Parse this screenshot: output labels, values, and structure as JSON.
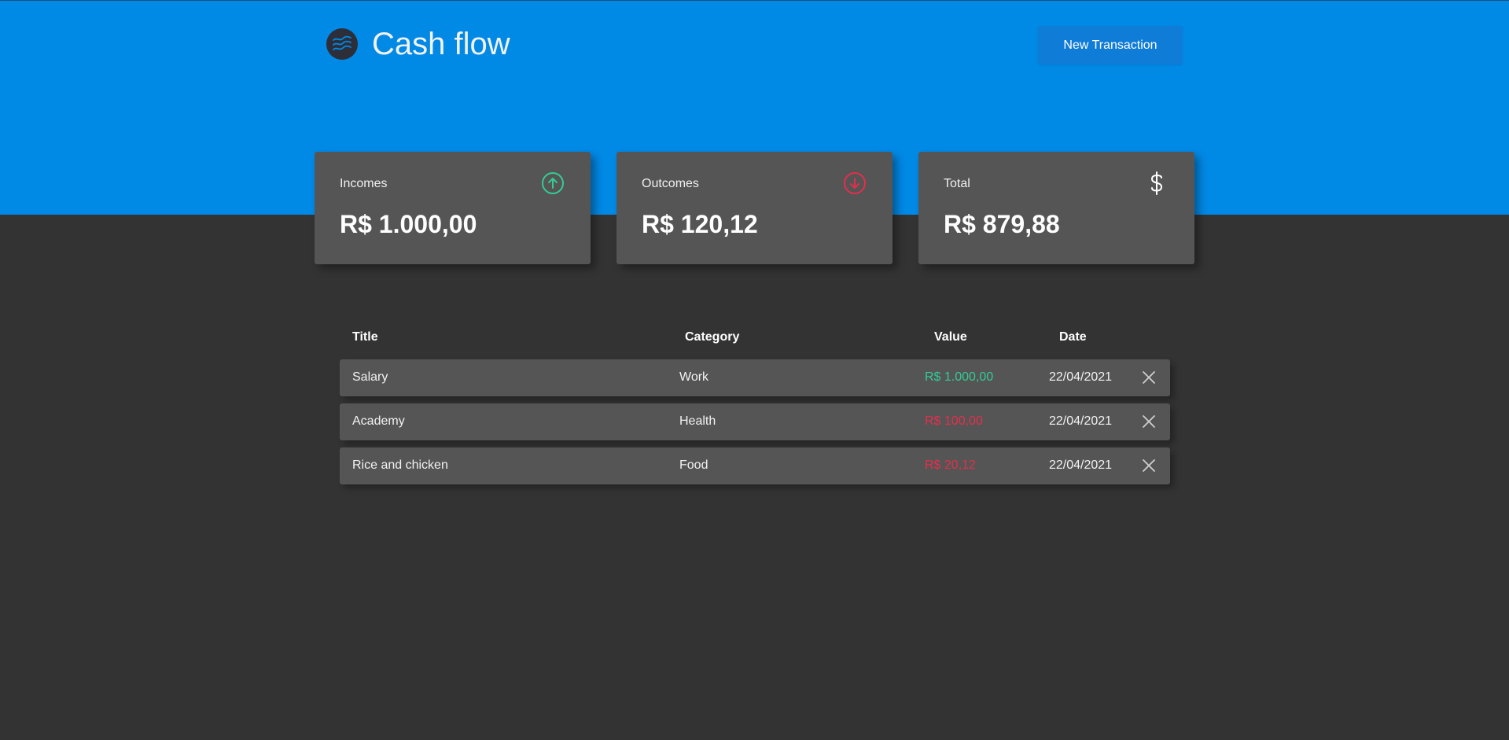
{
  "header": {
    "title": "Cash flow",
    "new_transaction_label": "New Transaction",
    "logo_icon": "wave-logo-icon"
  },
  "summary": [
    {
      "label": "Incomes",
      "value": "R$ 1.000,00",
      "icon": "arrow-up-circle-icon",
      "icon_color": "#33cc95"
    },
    {
      "label": "Outcomes",
      "value": "R$ 120,12",
      "icon": "arrow-down-circle-icon",
      "icon_color": "#e52e4d"
    },
    {
      "label": "Total",
      "value": "R$ 879,88",
      "icon": "dollar-sign-icon",
      "icon_color": "#ffffff"
    }
  ],
  "table": {
    "columns": [
      "Title",
      "Category",
      "Value",
      "Date"
    ],
    "rows": [
      {
        "title": "Salary",
        "category": "Work",
        "value": "R$ 1.000,00",
        "type": "income",
        "date": "22/04/2021"
      },
      {
        "title": "Academy",
        "category": "Health",
        "value": "R$ 100,00",
        "type": "outcome",
        "date": "22/04/2021"
      },
      {
        "title": "Rice and chicken",
        "category": "Food",
        "value": "R$ 20,12",
        "type": "outcome",
        "date": "22/04/2021"
      }
    ],
    "delete_icon": "close-icon"
  },
  "colors": {
    "header_bg": "#0189e6",
    "page_bg": "#333333",
    "card_bg": "#555555",
    "income": "#33cc95",
    "outcome": "#e52e4d",
    "button_bg": "#0f7cd8"
  }
}
